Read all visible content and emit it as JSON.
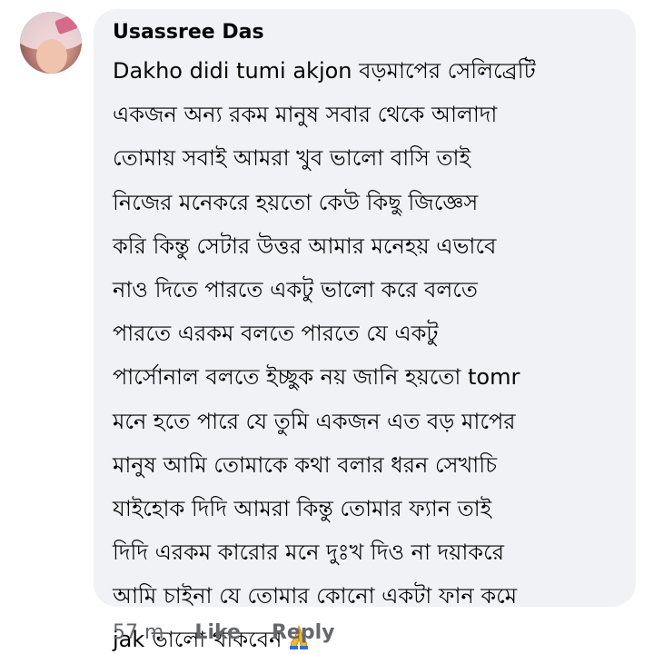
{
  "comment": {
    "author": "Usassree Das",
    "lines": [
      "Dakho didi tumi akjon বড়মাপের সেলিব্রেটি",
      "একজন অন্য রকম মানুষ সবার থেকে আলাদা",
      "তোমায় সবাই আমরা খুব ভালো বাসি তাই",
      "নিজের মনেকরে হয়তো কেউ কিছু জিজ্ঞেস",
      "করি কিন্তু সেটার উত্তর আমার মনেহয় এভাবে",
      "নাও দিতে পারতে  একটু ভালো করে বলতে",
      "পারতে এরকম বলতে পারতে যে একটু",
      "পার্সোনাল বলতে ইচ্ছুক নয় জানি হয়তো tomr",
      "মনে হতে পারে যে তুমি একজন এত বড় মাপের",
      "মানুষ আমি তোমাকে কথা বলার ধরন সেখাচি",
      "যাইহোক দিদি আমরা কিন্তু তোমার ফ্যান তাই",
      "দিদি এরকম কারোর মনে দুঃখ দিও না দয়াকরে",
      "আমি চাইনা যে তোমার কোনো একটা ফান কমে",
      "jak ভালো থাকবেন"
    ],
    "emoji_icon": "folded-hands-icon"
  },
  "actions": {
    "time": "57 m",
    "like": "Like",
    "reply": "Reply"
  },
  "colors": {
    "bubble": "#f0f2f5",
    "text": "#050505",
    "meta": "#65676b",
    "emoji": "#f5b82e"
  }
}
